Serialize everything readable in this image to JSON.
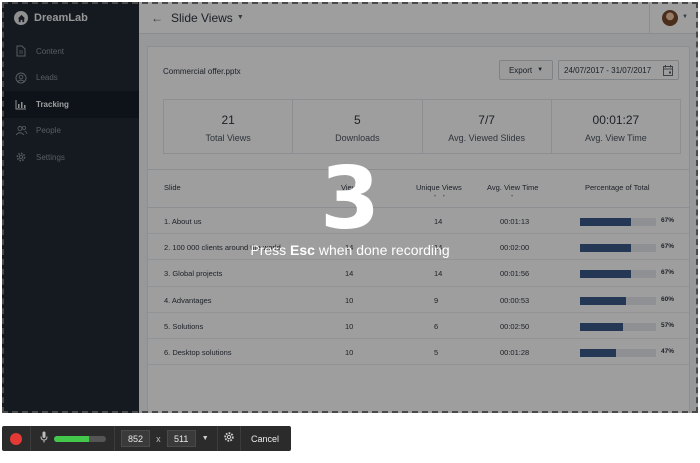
{
  "app": {
    "brand": "DreamLab",
    "sidebar": [
      {
        "label": "Content",
        "icon": "document-icon",
        "active": false
      },
      {
        "label": "Leads",
        "icon": "user-circle-icon",
        "active": false
      },
      {
        "label": "Tracking",
        "icon": "bar-chart-icon",
        "active": true
      },
      {
        "label": "People",
        "icon": "people-icon",
        "active": false
      },
      {
        "label": "Settings",
        "icon": "gear-icon",
        "active": false
      }
    ],
    "header": {
      "title": "Slide Views"
    },
    "file_name": "Commercial offer.pptx",
    "export_label": "Export",
    "date_range": "24/07/2017 - 31/07/2017",
    "stats": [
      {
        "value": "21",
        "label": "Total Views"
      },
      {
        "value": "5",
        "label": "Downloads"
      },
      {
        "value": "7/7",
        "label": "Avg. Viewed Slides"
      },
      {
        "value": "00:01:27",
        "label": "Avg. View Time"
      }
    ],
    "table": {
      "headers": {
        "slide": "Slide",
        "views": "Views",
        "unique": "Unique Views",
        "time": "Avg. View Time",
        "percent": "Percentage of Total"
      },
      "rows": [
        {
          "slide": "1. About us",
          "views": "14",
          "unique": "14",
          "time": "00:01:13",
          "percent": "67%",
          "fraction": 0.67
        },
        {
          "slide": "2. 100 000 clients around the world",
          "views": "14",
          "unique": "14",
          "time": "00:02:00",
          "percent": "67%",
          "fraction": 0.67
        },
        {
          "slide": "3. Global projects",
          "views": "14",
          "unique": "14",
          "time": "00:01:56",
          "percent": "67%",
          "fraction": 0.67
        },
        {
          "slide": "4. Advantages",
          "views": "10",
          "unique": "9",
          "time": "00:00:53",
          "percent": "60%",
          "fraction": 0.6
        },
        {
          "slide": "5. Solutions",
          "views": "10",
          "unique": "6",
          "time": "00:02:50",
          "percent": "57%",
          "fraction": 0.57
        },
        {
          "slide": "6. Desktop solutions",
          "views": "10",
          "unique": "5",
          "time": "00:01:28",
          "percent": "47%",
          "fraction": 0.47
        }
      ]
    }
  },
  "overlay": {
    "countdown": "3",
    "hint_before": "Press ",
    "hint_key": "Esc",
    "hint_after": " when done recording"
  },
  "recorder": {
    "width": "852",
    "height": "511",
    "separator": "x",
    "cancel_label": "Cancel",
    "mic_level": 0.68,
    "record_color": "#e53935",
    "meter_color": "#43c84b"
  }
}
